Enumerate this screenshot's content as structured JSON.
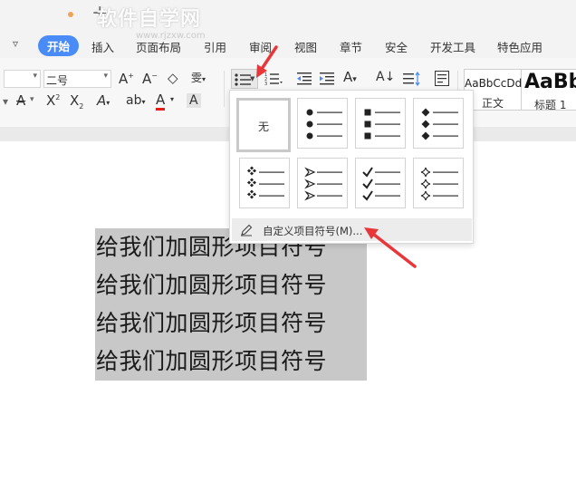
{
  "titlebar": {
    "watermark": "软件自学网",
    "watermark_url": "www.rjzxw.com"
  },
  "menubar": {
    "items": [
      {
        "label": "开始",
        "active": true
      },
      {
        "label": "插入",
        "active": false
      },
      {
        "label": "页面布局",
        "active": false
      },
      {
        "label": "引用",
        "active": false
      },
      {
        "label": "审阅",
        "active": false
      },
      {
        "label": "视图",
        "active": false
      },
      {
        "label": "章节",
        "active": false
      },
      {
        "label": "安全",
        "active": false
      },
      {
        "label": "开发工具",
        "active": false
      },
      {
        "label": "特色应用",
        "active": false
      }
    ]
  },
  "ribbon": {
    "font_size": "二号",
    "style_gallery": [
      {
        "sample": "AaBbCcDd",
        "name": "正文"
      },
      {
        "sample": "AaBb",
        "name": "标题 1"
      }
    ]
  },
  "bullet_dropdown": {
    "none_label": "无",
    "bullet_styles": [
      "none",
      "filled-circle",
      "filled-square",
      "filled-diamond",
      "four-diamond",
      "arrowhead",
      "check-mark",
      "outline-star"
    ],
    "custom_label": "自定义项目符号(M)..."
  },
  "document": {
    "lines": [
      "给我们加圆形项目符号",
      "给我们加圆形项目符号",
      "给我们加圆形项目符号",
      "给我们加圆形项目符号"
    ]
  },
  "colors": {
    "accent": "#4a8cf7",
    "annotation_arrow": "#e8373a",
    "selection": "#c8c8c8",
    "font_color_underline": "#e02020"
  }
}
